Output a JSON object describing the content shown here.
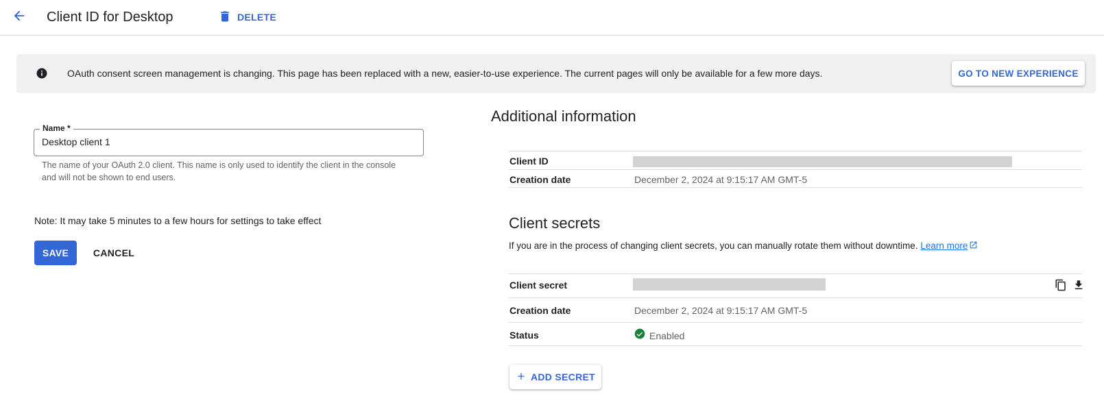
{
  "header": {
    "title": "Client ID for Desktop",
    "delete_label": "DELETE"
  },
  "banner": {
    "message": "OAuth consent screen management is changing. This page has been replaced with a new, easier-to-use experience. The current pages will only be available for a few more days.",
    "button_label": "GO TO NEW EXPERIENCE"
  },
  "form": {
    "name_label": "Name *",
    "name_value": "Desktop client 1",
    "name_hint": "The name of your OAuth 2.0 client. This name is only used to identify the client in the console and will not be shown to end users.",
    "note": "Note: It may take 5 minutes to a few hours for settings to take effect",
    "save_label": "SAVE",
    "cancel_label": "CANCEL"
  },
  "additional_info": {
    "title": "Additional information",
    "rows": [
      {
        "label": "Client ID",
        "value": ""
      },
      {
        "label": "Creation date",
        "value": "December 2, 2024 at 9:15:17 AM GMT-5"
      }
    ]
  },
  "client_secrets": {
    "title": "Client secrets",
    "description": "If you are in the process of changing client secrets, you can manually rotate them without downtime.",
    "learn_more": "Learn more",
    "rows": [
      {
        "label": "Client secret",
        "value": ""
      },
      {
        "label": "Creation date",
        "value": "December 2, 2024 at 9:15:17 AM GMT-5"
      },
      {
        "label": "Status",
        "value": "Enabled"
      }
    ],
    "add_secret_label": "ADD SECRET"
  },
  "colors": {
    "accent": "#3367d6",
    "link": "#1a73e8",
    "success": "#188038",
    "banner_bg": "#f1f1f1"
  },
  "icons": {
    "back": "arrow-back-icon",
    "delete": "trash-icon",
    "info": "info-icon",
    "copy": "copy-icon",
    "download": "download-icon",
    "external": "external-link-icon",
    "status": "check-circle-icon",
    "add": "plus-icon"
  }
}
